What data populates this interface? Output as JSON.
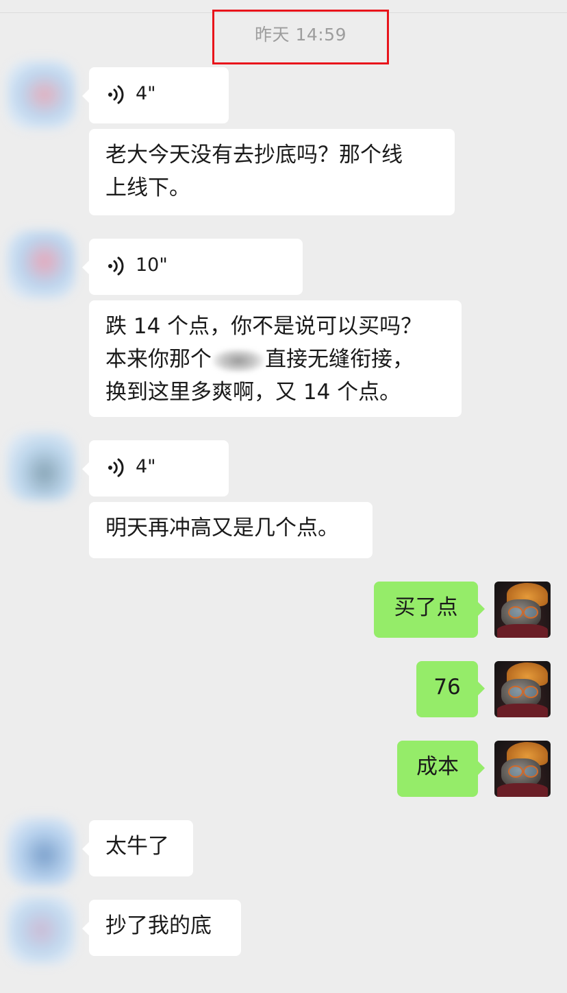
{
  "timestamp": "昨天 14:59",
  "messages": [
    {
      "type": "voice",
      "side": "left",
      "duration": "4\""
    },
    {
      "type": "text",
      "side": "left",
      "lines": [
        "老大今天没有去抄底吗？那个线",
        "上线下。"
      ]
    },
    {
      "type": "voice",
      "side": "left",
      "duration": "10\""
    },
    {
      "type": "text",
      "side": "left",
      "lines": [
        "跌 14 个点，你不是说可以买吗？",
        "本来你那个",
        "直接无缝衔接，",
        "换到这里多爽啊，又 14 个点。"
      ]
    },
    {
      "type": "voice",
      "side": "left",
      "duration": "4\""
    },
    {
      "type": "text",
      "side": "left",
      "text": "明天再冲高又是几个点。"
    },
    {
      "type": "text",
      "side": "right",
      "text": "买了点"
    },
    {
      "type": "text",
      "side": "right",
      "text": "76"
    },
    {
      "type": "text",
      "side": "right",
      "text": "成本"
    },
    {
      "type": "text",
      "side": "left",
      "text": "太牛了"
    },
    {
      "type": "text",
      "side": "left",
      "text": "抄了我的底"
    }
  ],
  "colors": {
    "background": "#ededed",
    "incoming": "#ffffff",
    "outgoing": "#95ec69",
    "highlight_box": "#e8141b"
  }
}
